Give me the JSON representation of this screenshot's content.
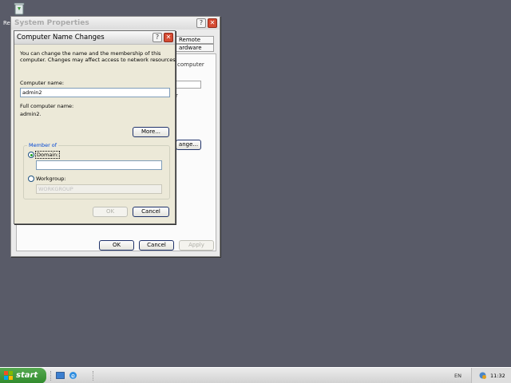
{
  "desktop": {
    "icon_name": "recycle-bin-icon",
    "icon_label_fragment": "Re"
  },
  "system_properties": {
    "title": "System Properties",
    "tab_remote": "Remote",
    "tab_hardware_fragment": "ardware",
    "frag_computer": "computer",
    "frag_r": "r",
    "change_button_fragment": "ange...",
    "ok_label": "OK",
    "cancel_label": "Cancel",
    "apply_label": "Apply"
  },
  "computer_name_changes": {
    "title": "Computer Name Changes",
    "description_line1": "You can change the name and the membership of this",
    "description_line2": "computer. Changes may affect access to network resources.",
    "computer_name_label": "Computer name:",
    "computer_name_value": "admin2",
    "full_name_label": "Full computer name:",
    "full_name_value": "admin2.",
    "more_label": "More...",
    "member_of_label": "Member of",
    "domain_label": "Domain:",
    "domain_value": "",
    "workgroup_label": "Workgroup:",
    "workgroup_value": "WORKGROUP",
    "ok_label": "OK",
    "cancel_label": "Cancel",
    "selected_membership": "Domain"
  },
  "taskbar": {
    "start_label": "start",
    "language": "EN",
    "clock": "11:32"
  },
  "colors": {
    "desktop": "#595b68",
    "close_button": "#d54b33",
    "start_button": "#3c9a38",
    "group_title": "#0046d5"
  }
}
